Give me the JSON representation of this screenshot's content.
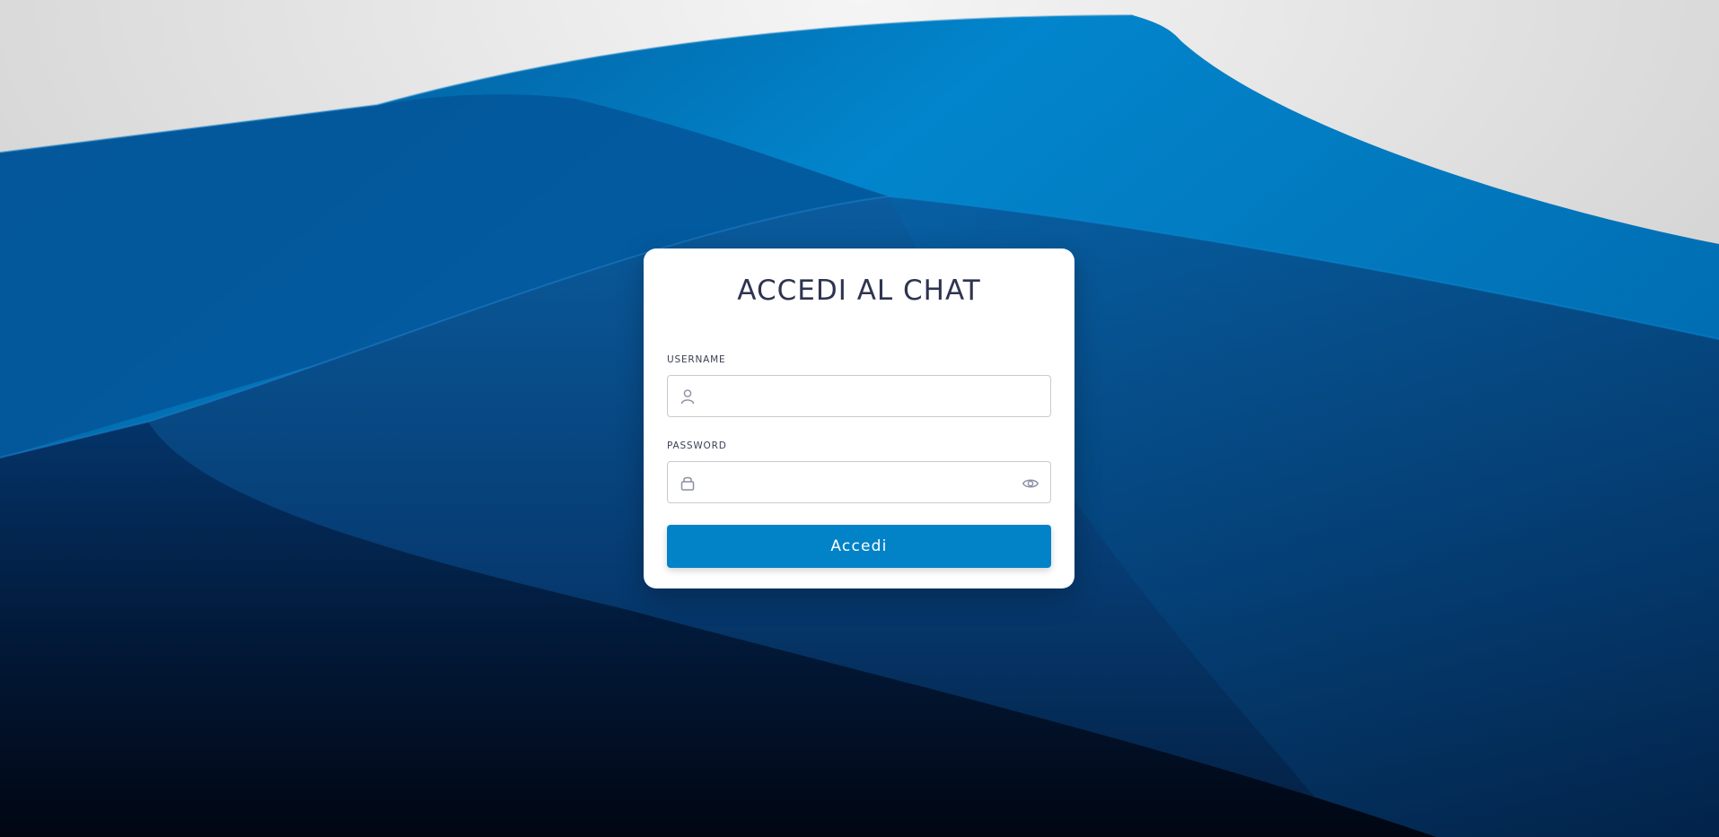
{
  "login": {
    "title": "ACCEDI AL CHAT",
    "username": {
      "label": "USERNAME",
      "value": "",
      "placeholder": ""
    },
    "password": {
      "label": "PASSWORD",
      "value": "",
      "placeholder": ""
    },
    "submit_label": "Accedi"
  },
  "icons": {
    "username": "user-icon",
    "password": "lock-icon",
    "toggle_password": "eye-icon"
  },
  "colors": {
    "accent": "#0383c7",
    "title": "#2e3450",
    "background_dark": "#020818",
    "background_light": "#ededed"
  }
}
